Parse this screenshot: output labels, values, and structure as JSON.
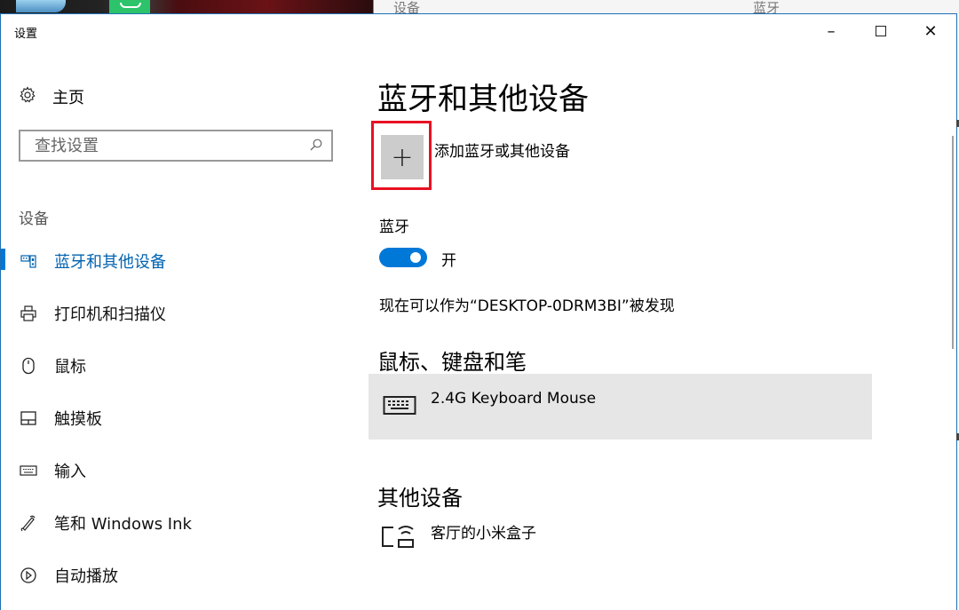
{
  "background": {
    "text_left": "设备",
    "text_right": "蓝牙"
  },
  "window": {
    "title": "设置",
    "controls": {
      "minimize": "–",
      "close": "✕"
    }
  },
  "sidebar": {
    "home_label": "主页",
    "search_placeholder": "查找设置",
    "section_label": "设备",
    "items": [
      {
        "label": "蓝牙和其他设备",
        "icon": "bluetooth-devices-icon",
        "active": true
      },
      {
        "label": "打印机和扫描仪",
        "icon": "printer-icon",
        "active": false
      },
      {
        "label": "鼠标",
        "icon": "mouse-icon",
        "active": false
      },
      {
        "label": "触摸板",
        "icon": "touchpad-icon",
        "active": false
      },
      {
        "label": "输入",
        "icon": "keyboard-icon",
        "active": false
      },
      {
        "label": "笔和 Windows Ink",
        "icon": "pen-icon",
        "active": false
      },
      {
        "label": "自动播放",
        "icon": "autoplay-icon",
        "active": false
      }
    ]
  },
  "main": {
    "title": "蓝牙和其他设备",
    "add_button_symbol": "+",
    "add_label": "添加蓝牙或其他设备",
    "bluetooth_label": "蓝牙",
    "toggle_state": "开",
    "discoverable_text": "现在可以作为“DESKTOP-0DRM3BI”被发现",
    "mouse_keyboard_heading": "鼠标、键盘和笔",
    "keyboard_device": "2.4G Keyboard Mouse",
    "other_heading": "其他设备",
    "other_device": "客厅的小米盒子"
  },
  "colors": {
    "accent": "#0078d7",
    "highlight": "#e81123",
    "device_row_bg": "#e6e6e6"
  }
}
